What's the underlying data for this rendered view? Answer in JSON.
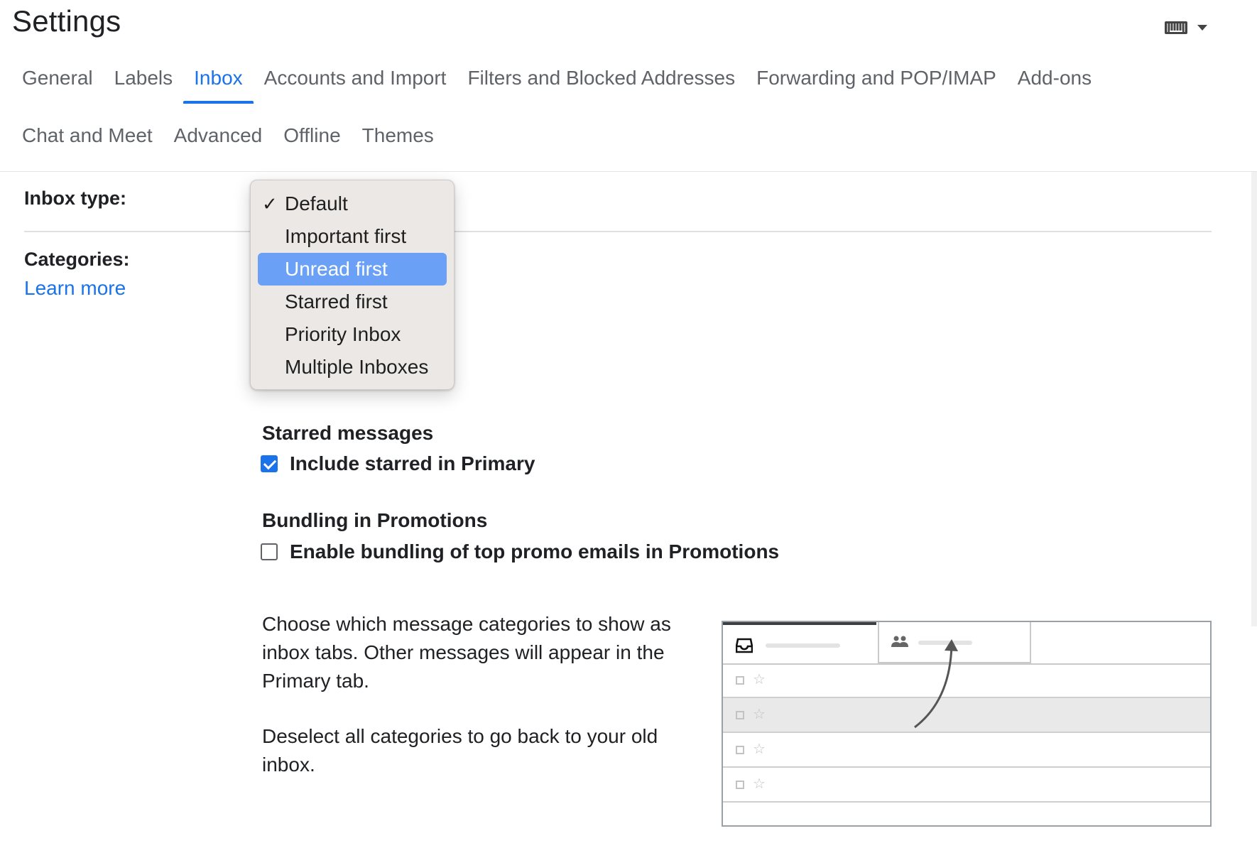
{
  "page": {
    "title": "Settings"
  },
  "tabs_row1": [
    {
      "label": "General",
      "active": false
    },
    {
      "label": "Labels",
      "active": false
    },
    {
      "label": "Inbox",
      "active": true
    },
    {
      "label": "Accounts and Import",
      "active": false
    },
    {
      "label": "Filters and Blocked Addresses",
      "active": false
    },
    {
      "label": "Forwarding and POP/IMAP",
      "active": false
    },
    {
      "label": "Add-ons",
      "active": false
    }
  ],
  "tabs_row2": [
    {
      "label": "Chat and Meet",
      "active": false
    },
    {
      "label": "Advanced",
      "active": false
    },
    {
      "label": "Offline",
      "active": false
    },
    {
      "label": "Themes",
      "active": false
    }
  ],
  "inbox_type": {
    "label": "Inbox type:",
    "current_value": "Default",
    "options": [
      "Default",
      "Important first",
      "Unread first",
      "Starred first",
      "Priority Inbox",
      "Multiple Inboxes"
    ],
    "checked_option": "Default",
    "highlighted_option": "Unread first"
  },
  "categories": {
    "label": "Categories:",
    "learn_more": "Learn more"
  },
  "starred_messages": {
    "title": "Starred messages",
    "checkbox_label": "Include starred in Primary",
    "checked": true
  },
  "bundling": {
    "title": "Bundling in Promotions",
    "checkbox_label": "Enable bundling of top promo emails in Promotions",
    "checked": false
  },
  "description": {
    "p1": "Choose which message categories to show as inbox tabs. Other messages will appear in the Primary tab.",
    "p2": "Deselect all categories to go back to your old inbox."
  },
  "icons": {
    "keyboard": "keyboard-icon",
    "dropdown_caret": "caret-down-icon",
    "check": "checkmark-icon",
    "inbox_tray": "inbox-tray-icon",
    "people": "people-icon",
    "star": "star-outline-icon"
  },
  "colors": {
    "accent": "#1a73e8",
    "menu_highlight": "#6aa1f6",
    "menu_bg": "#ece8e6"
  }
}
